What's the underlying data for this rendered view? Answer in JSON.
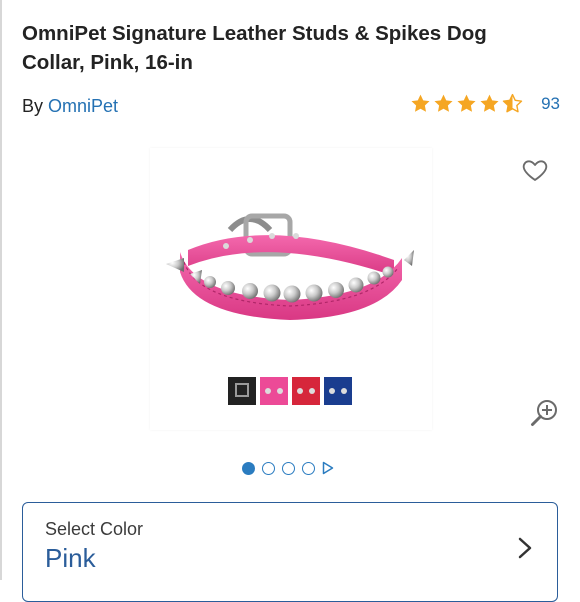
{
  "product": {
    "title": "OmniPet Signature Leather Studs & Spikes Dog Collar, Pink, 16-in",
    "by_label": "By",
    "brand": "OmniPet",
    "rating": {
      "stars": 4.5,
      "max": 5,
      "review_count": "93"
    }
  },
  "gallery": {
    "image_count": 4,
    "active_index": 0
  },
  "colors": {
    "accent": "#2b7cc0",
    "link": "#2471b3",
    "star": "#f5a623",
    "collar_pink": "#ec4a97",
    "select_border": "#2b5d9a",
    "swatches": [
      "#222222",
      "#ec4a97",
      "#d6263b",
      "#1a3d8f"
    ]
  },
  "icons": {
    "favorite": "heart-outline-icon",
    "zoom": "zoom-in-icon",
    "select_arrow": "chevron-right-icon",
    "pager_next": "play-triangle-icon"
  },
  "color_select": {
    "label": "Select Color",
    "value": "Pink"
  }
}
